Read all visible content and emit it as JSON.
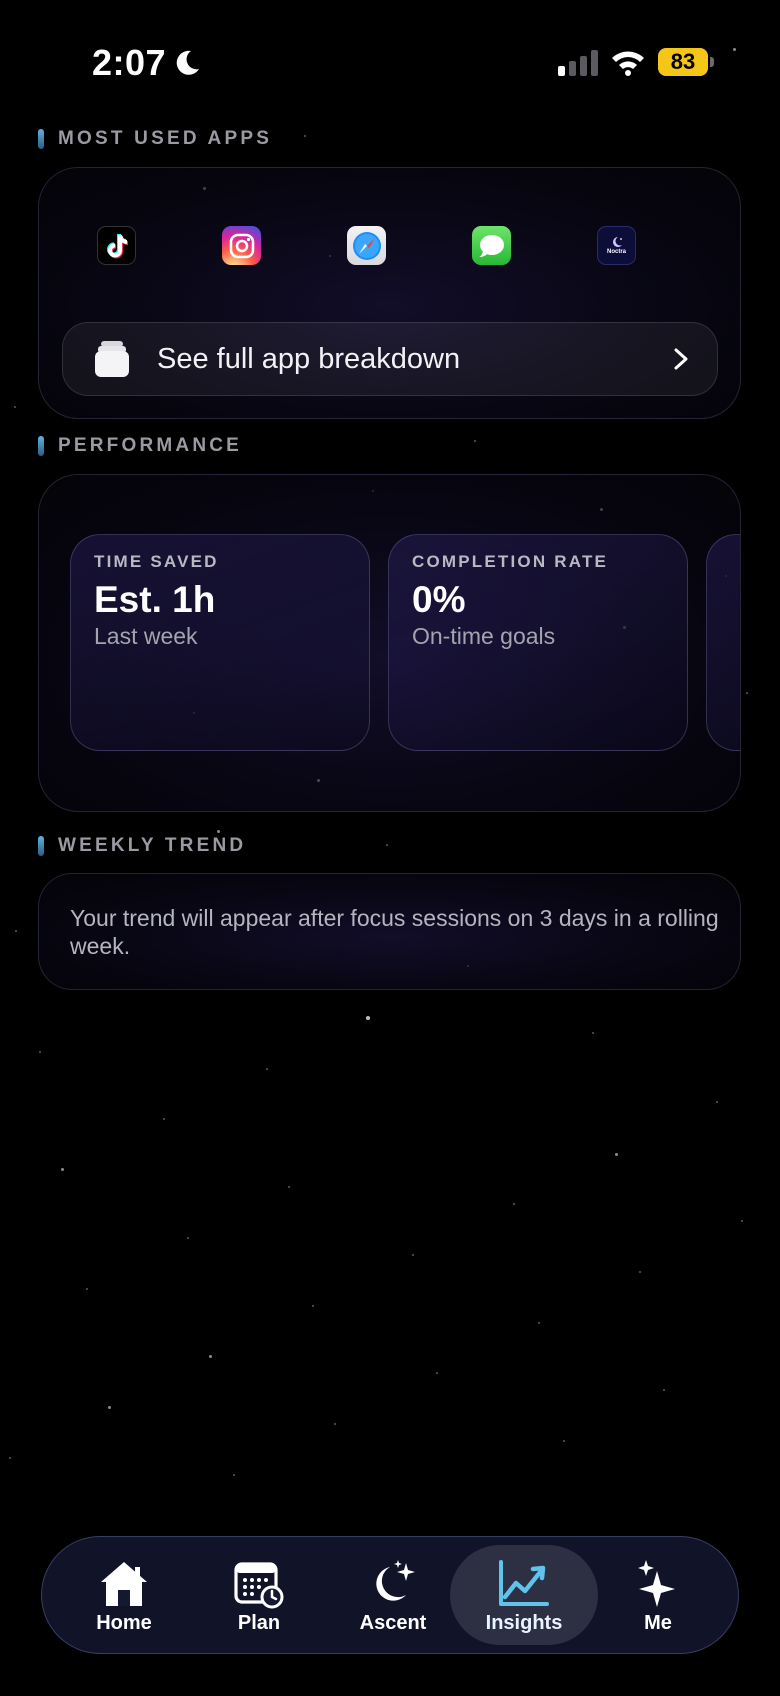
{
  "status_bar": {
    "time": "2:07",
    "battery": "83"
  },
  "sections": {
    "most_used_apps": "MOST USED APPS",
    "performance": "PERFORMANCE",
    "weekly_trend": "WEEKLY TREND"
  },
  "apps": [
    {
      "name": "TikTok",
      "icon": "tiktok-icon"
    },
    {
      "name": "Instagram",
      "icon": "instagram-icon"
    },
    {
      "name": "Safari",
      "icon": "safari-icon"
    },
    {
      "name": "Messages",
      "icon": "messages-icon"
    },
    {
      "name": "Noctra",
      "icon": "noctra-icon",
      "icon_text": "Noctra"
    }
  ],
  "breakdown_button": {
    "label": "See full app breakdown"
  },
  "performance": [
    {
      "label": "TIME SAVED",
      "value": "Est. 1h",
      "sub": "Last week"
    },
    {
      "label": "COMPLETION RATE",
      "value": "0%",
      "sub": "On-time goals"
    }
  ],
  "weekly_trend": {
    "message": "Your trend will appear after focus sessions on 3 days in a rolling week."
  },
  "tab_bar": {
    "tabs": [
      {
        "label": "Home",
        "icon": "home-icon"
      },
      {
        "label": "Plan",
        "icon": "calendar-icon"
      },
      {
        "label": "Ascent",
        "icon": "moon-sparkle-icon"
      },
      {
        "label": "Insights",
        "icon": "chart-trend-icon",
        "active": true
      },
      {
        "label": "Me",
        "icon": "sparkles-icon"
      }
    ]
  },
  "colors": {
    "accent": "#5fc3ea",
    "background": "#000000",
    "battery": "#f5c518"
  }
}
